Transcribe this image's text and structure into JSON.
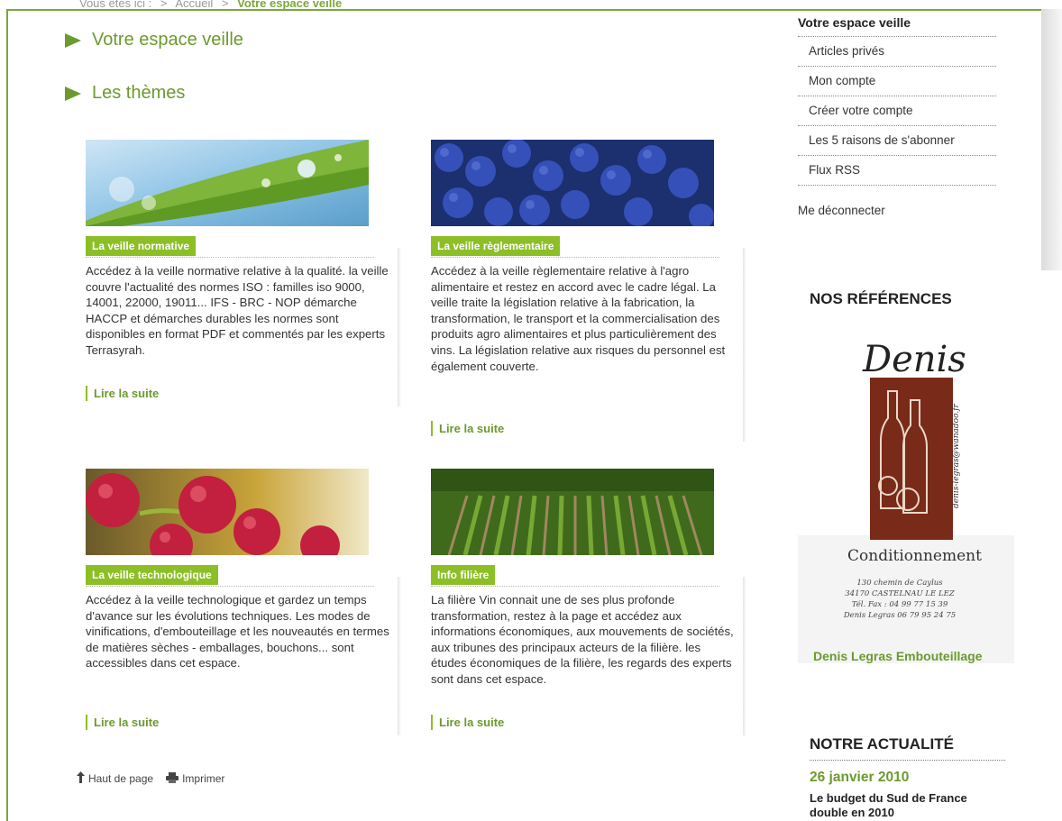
{
  "breadcrumb": {
    "prefix": "Vous êtes ici :",
    "home": "Accueil",
    "separator": ">",
    "current": "Votre espace veille"
  },
  "sections": {
    "espace_veille": "Votre espace veille",
    "themes": "Les thèmes"
  },
  "cards": [
    {
      "title": "La veille normative",
      "description": "Accédez à la veille normative relative à la qualité. la veille couvre l'actualité des normes ISO : familles iso 9000, 14001, 22000, 19011... IFS - BRC - NOP démarche HACCP et démarches durables les normes sont disponibles en format PDF et commentés par les experts Terrasyrah.",
      "more": "Lire la suite"
    },
    {
      "title": "La veille règlementaire",
      "description": "Accédez à la veille règlementaire relative à l'agro alimentaire et restez en accord avec le cadre légal. La veille traite la législation relative à la fabrication, la transformation, le transport et la commercialisation des produits agro alimentaires et plus particulièrement des vins. La législation relative aux risques du personnel est également couverte.",
      "more": "Lire la suite"
    },
    {
      "title": "La veille technologique",
      "description": "Accédez à la veille technologique et gardez un temps d'avance sur les évolutions techniques. Les modes de vinifications, d'embouteillage et les nouveautés en termes de matières sèches - emballages, bouchons... sont accessibles dans cet espace.",
      "more": "Lire la suite"
    },
    {
      "title": "Info filière",
      "description": "La filière Vin connait une de ses plus profonde transformation, restez à la page et accédez aux informations économiques, aux mouvements de sociétés, aux tribunes des principaux acteurs de la filière. les études économiques de la filière, les regards des experts sont dans cet espace.",
      "more": "Lire la suite"
    }
  ],
  "footer": {
    "top": "Haut de page",
    "print": "Imprimer"
  },
  "sidebar": {
    "heading": "Votre espace veille",
    "items": [
      "Articles privés",
      "Mon compte",
      "Créer votre compte",
      "Les 5 raisons de s'abonner",
      "Flux RSS"
    ],
    "logout": "Me déconnecter"
  },
  "references": {
    "heading": "NOS RÉFÉRENCES",
    "logo_name": "Denis",
    "logo_tag": "Conditionnement",
    "logo_email": "denis-legras@wanadoo.fr",
    "address": [
      "130 chemin de Caylus",
      "34170 CASTELNAU LE LEZ",
      "Tél. Fax : 04 99 77 15 39",
      "Denis Legras 06 79 95 24 75"
    ],
    "caption": "Denis Legras Embouteillage"
  },
  "news": {
    "heading": "NOTRE ACTUALITÉ",
    "date": "26 janvier 2010",
    "headline": "Le budget du Sud de France double en 2010"
  },
  "colors": {
    "accent": "#8cbf26",
    "accent_text": "#6b9a2e",
    "frame": "#7aa83a"
  }
}
